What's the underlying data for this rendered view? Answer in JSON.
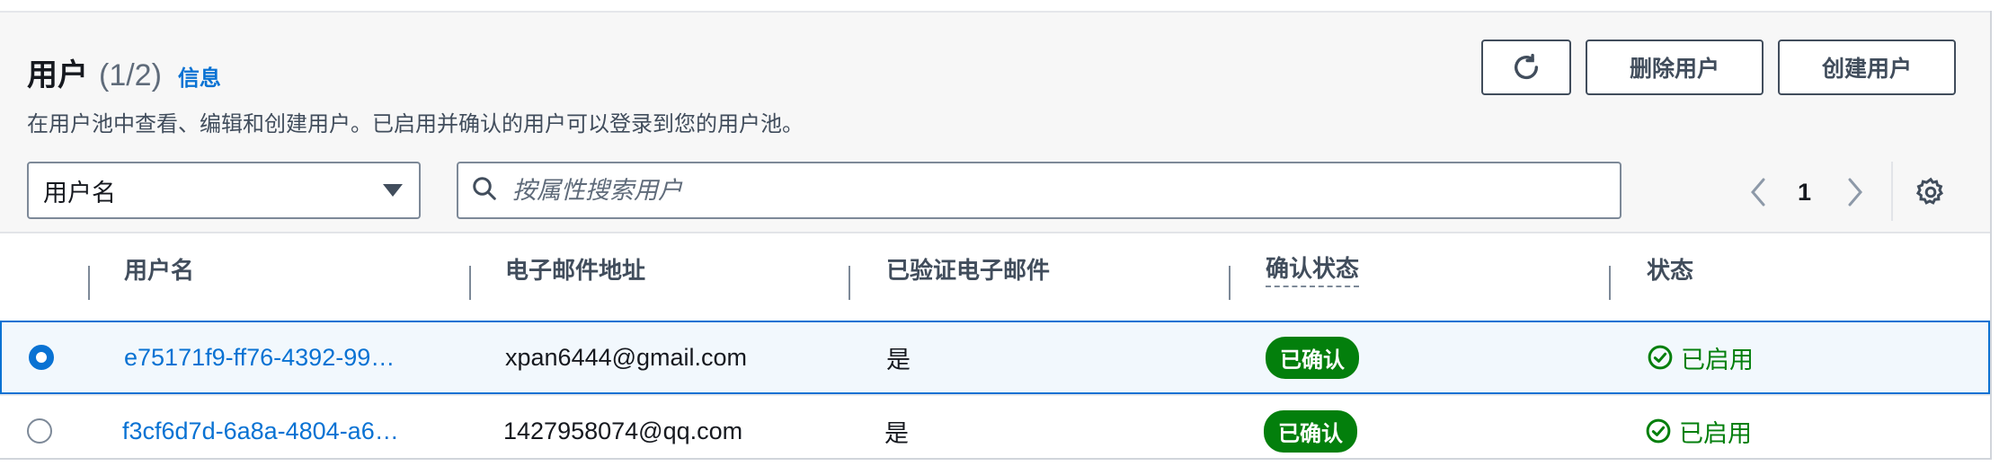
{
  "header": {
    "title": "用户",
    "count": "(1/2)",
    "info_link": "信息",
    "description": "在用户池中查看、编辑和创建用户。已启用并确认的用户可以登录到您的用户池。"
  },
  "actions": {
    "refresh_icon": "refresh-icon",
    "delete_label": "删除用户",
    "create_label": "创建用户"
  },
  "filter": {
    "property_value": "用户名",
    "search_placeholder": "按属性搜索用户"
  },
  "pagination": {
    "current_page": "1"
  },
  "table": {
    "columns": [
      "用户名",
      "电子邮件地址",
      "已验证电子邮件",
      "确认状态",
      "状态"
    ],
    "rows": [
      {
        "selected": true,
        "username": "e75171f9-ff76-4392-99…",
        "email": "xpan6444@gmail.com",
        "email_verified": "是",
        "confirmation": "已确认",
        "status": "已启用"
      },
      {
        "selected": false,
        "username": "f3cf6d7d-6a8a-4804-a6…",
        "email": "1427958074@qq.com",
        "email_verified": "是",
        "confirmation": "已确认",
        "status": "已启用"
      }
    ]
  },
  "colors": {
    "accent": "#0972d3",
    "success": "#037f0c",
    "text": "#16191f"
  }
}
